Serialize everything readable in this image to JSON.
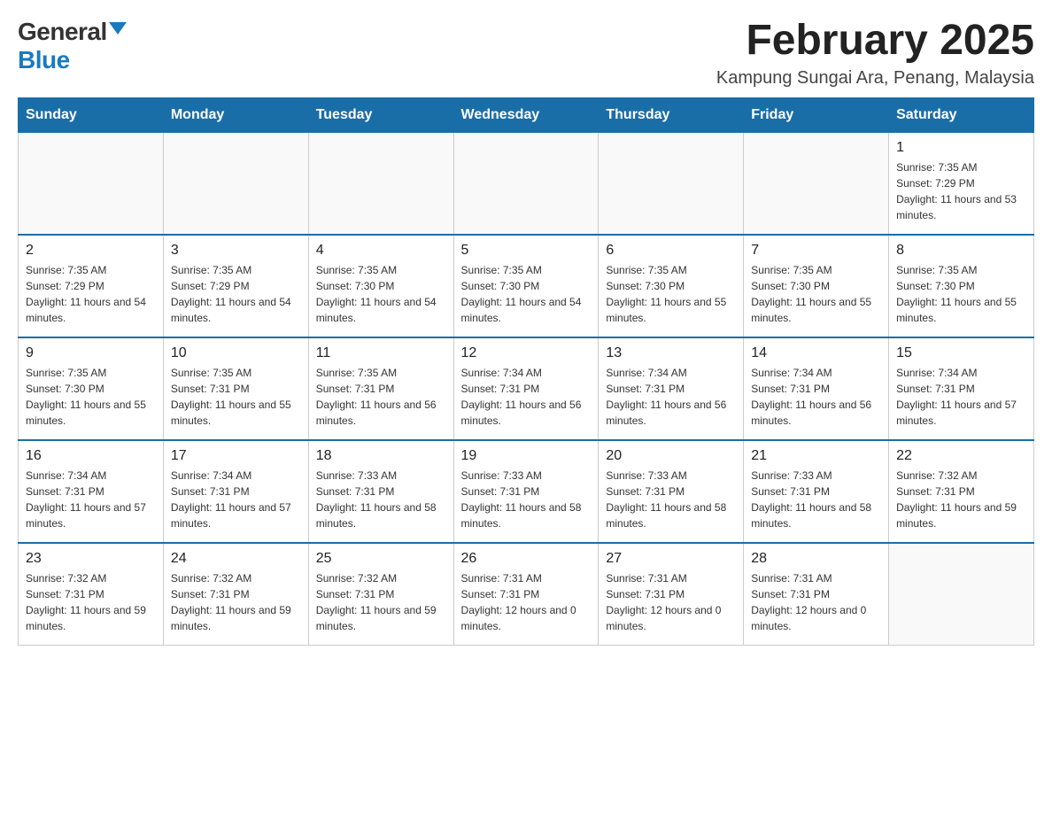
{
  "logo": {
    "general": "General",
    "blue": "Blue"
  },
  "title": {
    "month_year": "February 2025",
    "location": "Kampung Sungai Ara, Penang, Malaysia"
  },
  "days_of_week": [
    "Sunday",
    "Monday",
    "Tuesday",
    "Wednesday",
    "Thursday",
    "Friday",
    "Saturday"
  ],
  "weeks": [
    [
      {
        "day": "",
        "sunrise": "",
        "sunset": "",
        "daylight": ""
      },
      {
        "day": "",
        "sunrise": "",
        "sunset": "",
        "daylight": ""
      },
      {
        "day": "",
        "sunrise": "",
        "sunset": "",
        "daylight": ""
      },
      {
        "day": "",
        "sunrise": "",
        "sunset": "",
        "daylight": ""
      },
      {
        "day": "",
        "sunrise": "",
        "sunset": "",
        "daylight": ""
      },
      {
        "day": "",
        "sunrise": "",
        "sunset": "",
        "daylight": ""
      },
      {
        "day": "1",
        "sunrise": "Sunrise: 7:35 AM",
        "sunset": "Sunset: 7:29 PM",
        "daylight": "Daylight: 11 hours and 53 minutes."
      }
    ],
    [
      {
        "day": "2",
        "sunrise": "Sunrise: 7:35 AM",
        "sunset": "Sunset: 7:29 PM",
        "daylight": "Daylight: 11 hours and 54 minutes."
      },
      {
        "day": "3",
        "sunrise": "Sunrise: 7:35 AM",
        "sunset": "Sunset: 7:29 PM",
        "daylight": "Daylight: 11 hours and 54 minutes."
      },
      {
        "day": "4",
        "sunrise": "Sunrise: 7:35 AM",
        "sunset": "Sunset: 7:30 PM",
        "daylight": "Daylight: 11 hours and 54 minutes."
      },
      {
        "day": "5",
        "sunrise": "Sunrise: 7:35 AM",
        "sunset": "Sunset: 7:30 PM",
        "daylight": "Daylight: 11 hours and 54 minutes."
      },
      {
        "day": "6",
        "sunrise": "Sunrise: 7:35 AM",
        "sunset": "Sunset: 7:30 PM",
        "daylight": "Daylight: 11 hours and 55 minutes."
      },
      {
        "day": "7",
        "sunrise": "Sunrise: 7:35 AM",
        "sunset": "Sunset: 7:30 PM",
        "daylight": "Daylight: 11 hours and 55 minutes."
      },
      {
        "day": "8",
        "sunrise": "Sunrise: 7:35 AM",
        "sunset": "Sunset: 7:30 PM",
        "daylight": "Daylight: 11 hours and 55 minutes."
      }
    ],
    [
      {
        "day": "9",
        "sunrise": "Sunrise: 7:35 AM",
        "sunset": "Sunset: 7:30 PM",
        "daylight": "Daylight: 11 hours and 55 minutes."
      },
      {
        "day": "10",
        "sunrise": "Sunrise: 7:35 AM",
        "sunset": "Sunset: 7:31 PM",
        "daylight": "Daylight: 11 hours and 55 minutes."
      },
      {
        "day": "11",
        "sunrise": "Sunrise: 7:35 AM",
        "sunset": "Sunset: 7:31 PM",
        "daylight": "Daylight: 11 hours and 56 minutes."
      },
      {
        "day": "12",
        "sunrise": "Sunrise: 7:34 AM",
        "sunset": "Sunset: 7:31 PM",
        "daylight": "Daylight: 11 hours and 56 minutes."
      },
      {
        "day": "13",
        "sunrise": "Sunrise: 7:34 AM",
        "sunset": "Sunset: 7:31 PM",
        "daylight": "Daylight: 11 hours and 56 minutes."
      },
      {
        "day": "14",
        "sunrise": "Sunrise: 7:34 AM",
        "sunset": "Sunset: 7:31 PM",
        "daylight": "Daylight: 11 hours and 56 minutes."
      },
      {
        "day": "15",
        "sunrise": "Sunrise: 7:34 AM",
        "sunset": "Sunset: 7:31 PM",
        "daylight": "Daylight: 11 hours and 57 minutes."
      }
    ],
    [
      {
        "day": "16",
        "sunrise": "Sunrise: 7:34 AM",
        "sunset": "Sunset: 7:31 PM",
        "daylight": "Daylight: 11 hours and 57 minutes."
      },
      {
        "day": "17",
        "sunrise": "Sunrise: 7:34 AM",
        "sunset": "Sunset: 7:31 PM",
        "daylight": "Daylight: 11 hours and 57 minutes."
      },
      {
        "day": "18",
        "sunrise": "Sunrise: 7:33 AM",
        "sunset": "Sunset: 7:31 PM",
        "daylight": "Daylight: 11 hours and 58 minutes."
      },
      {
        "day": "19",
        "sunrise": "Sunrise: 7:33 AM",
        "sunset": "Sunset: 7:31 PM",
        "daylight": "Daylight: 11 hours and 58 minutes."
      },
      {
        "day": "20",
        "sunrise": "Sunrise: 7:33 AM",
        "sunset": "Sunset: 7:31 PM",
        "daylight": "Daylight: 11 hours and 58 minutes."
      },
      {
        "day": "21",
        "sunrise": "Sunrise: 7:33 AM",
        "sunset": "Sunset: 7:31 PM",
        "daylight": "Daylight: 11 hours and 58 minutes."
      },
      {
        "day": "22",
        "sunrise": "Sunrise: 7:32 AM",
        "sunset": "Sunset: 7:31 PM",
        "daylight": "Daylight: 11 hours and 59 minutes."
      }
    ],
    [
      {
        "day": "23",
        "sunrise": "Sunrise: 7:32 AM",
        "sunset": "Sunset: 7:31 PM",
        "daylight": "Daylight: 11 hours and 59 minutes."
      },
      {
        "day": "24",
        "sunrise": "Sunrise: 7:32 AM",
        "sunset": "Sunset: 7:31 PM",
        "daylight": "Daylight: 11 hours and 59 minutes."
      },
      {
        "day": "25",
        "sunrise": "Sunrise: 7:32 AM",
        "sunset": "Sunset: 7:31 PM",
        "daylight": "Daylight: 11 hours and 59 minutes."
      },
      {
        "day": "26",
        "sunrise": "Sunrise: 7:31 AM",
        "sunset": "Sunset: 7:31 PM",
        "daylight": "Daylight: 12 hours and 0 minutes."
      },
      {
        "day": "27",
        "sunrise": "Sunrise: 7:31 AM",
        "sunset": "Sunset: 7:31 PM",
        "daylight": "Daylight: 12 hours and 0 minutes."
      },
      {
        "day": "28",
        "sunrise": "Sunrise: 7:31 AM",
        "sunset": "Sunset: 7:31 PM",
        "daylight": "Daylight: 12 hours and 0 minutes."
      },
      {
        "day": "",
        "sunrise": "",
        "sunset": "",
        "daylight": ""
      }
    ]
  ]
}
